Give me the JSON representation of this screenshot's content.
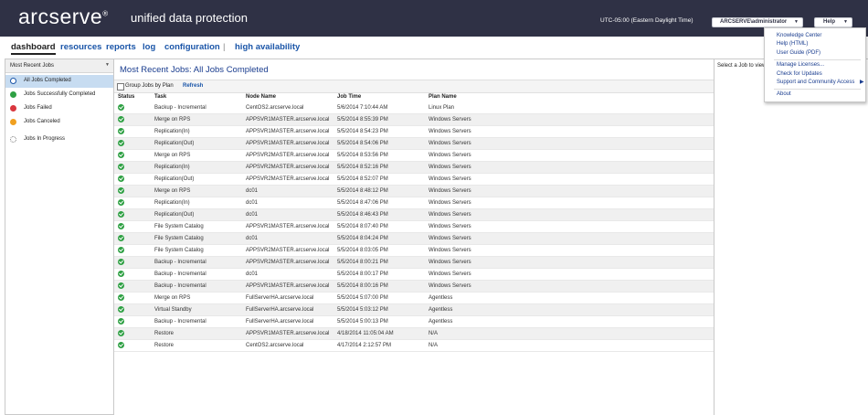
{
  "header": {
    "logo": "arcserve",
    "logo_mark": "®",
    "product": "unified data protection",
    "timezone": "UTC-05:00 (Eastern Daylight Time)",
    "user": "ARCSERVE\\administrator",
    "help": "Help"
  },
  "help_menu": {
    "items": [
      "Knowledge Center",
      "Help (HTML)",
      "User Guide (PDF)",
      "Manage Licenses...",
      "Check for Updates",
      "Support and Community Access",
      "About"
    ]
  },
  "nav": {
    "items": [
      "dashboard",
      "resources",
      "reports",
      "log",
      "configuration",
      "high availability"
    ],
    "separator": "|"
  },
  "left_panel": {
    "dropdown": "Most Recent Jobs",
    "items": [
      "All Jobs Completed",
      "Jobs Successfully Completed",
      "Jobs Failed",
      "Jobs Canceled",
      "Jobs In Progress"
    ]
  },
  "main": {
    "title": "Most Recent Jobs: All Jobs Completed",
    "group_label": "Group Jobs by Plan",
    "refresh": "Refresh",
    "columns": [
      "Status",
      "Task",
      "Node Name",
      "Job Time",
      "Plan Name"
    ],
    "rows": [
      [
        "Backup - Incremental",
        "CentOS2.arcserve.local",
        "5/6/2014 7:10:44 AM",
        "Linux Plan"
      ],
      [
        "Merge on RPS",
        "APPSVR1MASTER.arcserve.local",
        "5/5/2014 8:55:39 PM",
        "Windows Servers"
      ],
      [
        "Replication(In)",
        "APPSVR1MASTER.arcserve.local",
        "5/5/2014 8:54:23 PM",
        "Windows Servers"
      ],
      [
        "Replication(Out)",
        "APPSVR1MASTER.arcserve.local",
        "5/5/2014 8:54:06 PM",
        "Windows Servers"
      ],
      [
        "Merge on RPS",
        "APPSVR2MASTER.arcserve.local",
        "5/5/2014 8:53:56 PM",
        "Windows Servers"
      ],
      [
        "Replication(In)",
        "APPSVR2MASTER.arcserve.local",
        "5/5/2014 8:52:16 PM",
        "Windows Servers"
      ],
      [
        "Replication(Out)",
        "APPSVR2MASTER.arcserve.local",
        "5/5/2014 8:52:07 PM",
        "Windows Servers"
      ],
      [
        "Merge on RPS",
        "dc01",
        "5/5/2014 8:48:12 PM",
        "Windows Servers"
      ],
      [
        "Replication(In)",
        "dc01",
        "5/5/2014 8:47:06 PM",
        "Windows Servers"
      ],
      [
        "Replication(Out)",
        "dc01",
        "5/5/2014 8:46:43 PM",
        "Windows Servers"
      ],
      [
        "File System Catalog",
        "APPSVR1MASTER.arcserve.local",
        "5/5/2014 8:07:40 PM",
        "Windows Servers"
      ],
      [
        "File System Catalog",
        "dc01",
        "5/5/2014 8:04:24 PM",
        "Windows Servers"
      ],
      [
        "File System Catalog",
        "APPSVR2MASTER.arcserve.local",
        "5/5/2014 8:03:05 PM",
        "Windows Servers"
      ],
      [
        "Backup - Incremental",
        "APPSVR2MASTER.arcserve.local",
        "5/5/2014 8:00:21 PM",
        "Windows Servers"
      ],
      [
        "Backup - Incremental",
        "dc01",
        "5/5/2014 8:00:17 PM",
        "Windows Servers"
      ],
      [
        "Backup - Incremental",
        "APPSVR1MASTER.arcserve.local",
        "5/5/2014 8:00:16 PM",
        "Windows Servers"
      ],
      [
        "Merge on RPS",
        "FullServerHA.arcserve.local",
        "5/5/2014 5:07:00 PM",
        "Agentless"
      ],
      [
        "Virtual Standby",
        "FullServerHA.arcserve.local",
        "5/5/2014 5:03:12 PM",
        "Agentless"
      ],
      [
        "Backup - Incremental",
        "FullServerHA.arcserve.local",
        "5/5/2014 5:00:13 PM",
        "Agentless"
      ],
      [
        "Restore",
        "APPSVR1MASTER.arcserve.local",
        "4/18/2014 11:05:04 AM",
        "N/A"
      ],
      [
        "Restore",
        "CentOS2.arcserve.local",
        "4/17/2014 2:12:57 PM",
        "N/A"
      ]
    ]
  },
  "right_panel": {
    "text": "Select a Job to view"
  },
  "colors": {
    "header_bg": "#2f3145",
    "link": "#1a55a8",
    "success": "#2ea043",
    "failed": "#d9363e",
    "canceled": "#f0a020",
    "selected": "#c7dcf1"
  }
}
